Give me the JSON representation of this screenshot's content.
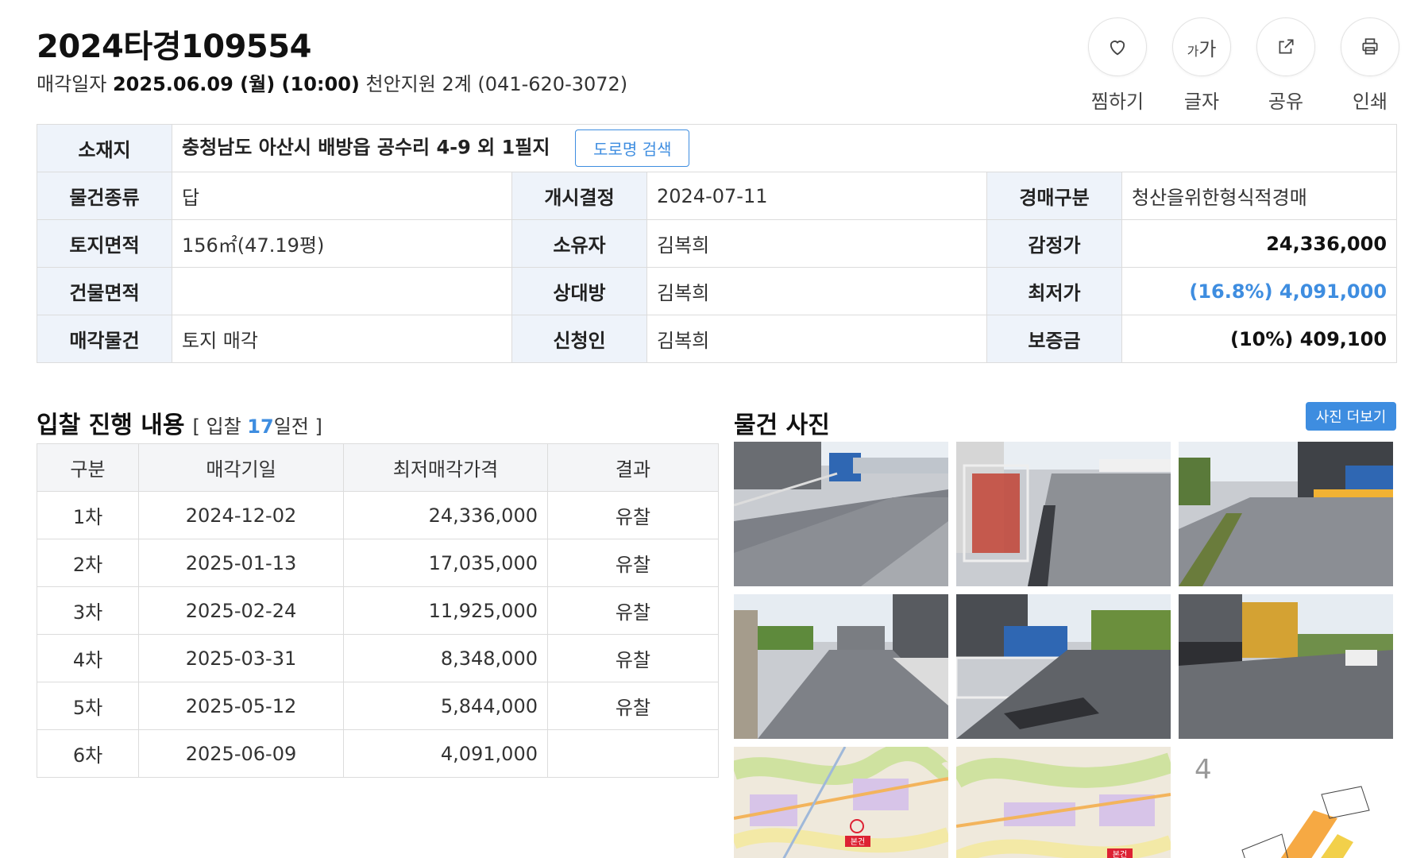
{
  "case": {
    "number": "2024타경109554",
    "sale_date_label": "매각일자",
    "sale_date": "2025.06.09 (월) (10:00)",
    "court": "천안지원 2계 (041-620-3072)"
  },
  "tools": {
    "like": "찜하기",
    "font_icon_small": "가",
    "font_icon_big": "가",
    "font": "글자",
    "share": "공유",
    "print": "인쇄"
  },
  "info": {
    "location_label": "소재지",
    "location": "충청남도 아산시 배방읍 공수리 4-9 외 1필지",
    "road_search": "도로명 검색",
    "type_label": "물건종류",
    "type": "답",
    "start_label": "개시결정",
    "start": "2024-07-11",
    "auction_kind_label": "경매구분",
    "auction_kind": "청산을위한형식적경매",
    "land_label": "토지면적",
    "land": "156㎡(47.19평)",
    "owner_label": "소유자",
    "owner": "김복희",
    "appraisal_label": "감정가",
    "appraisal": "24,336,000",
    "building_label": "건물면적",
    "building": "",
    "counterpart_label": "상대방",
    "counterpart": "김복희",
    "min_label": "최저가",
    "min": "(16.8%) 4,091,000",
    "sale_item_label": "매각물건",
    "sale_item": "토지 매각",
    "applicant_label": "신청인",
    "applicant": "김복희",
    "deposit_label": "보증금",
    "deposit": "(10%) 409,100"
  },
  "bidding": {
    "title": "입찰 진행 내용",
    "sub_open": "[ 입찰 ",
    "days": "17",
    "sub_close": "일전 ]",
    "headers": [
      "구분",
      "매각기일",
      "최저매각가격",
      "결과"
    ],
    "rows": [
      [
        "1차",
        "2024-12-02",
        "24,336,000",
        "유찰"
      ],
      [
        "2차",
        "2025-01-13",
        "17,035,000",
        "유찰"
      ],
      [
        "3차",
        "2025-02-24",
        "11,925,000",
        "유찰"
      ],
      [
        "4차",
        "2025-03-31",
        "8,348,000",
        "유찰"
      ],
      [
        "5차",
        "2025-05-12",
        "5,844,000",
        "유찰"
      ],
      [
        "6차",
        "2025-06-09",
        "4,091,000",
        ""
      ]
    ]
  },
  "photos": {
    "title": "물건 사진",
    "more": "사진 더보기",
    "map_marker_1": "본건",
    "map_marker_2": "본건",
    "diagram_numeral": "4",
    "items": [
      "road-photo",
      "road-photo",
      "road-photo",
      "road-photo",
      "road-photo",
      "road-photo",
      "map-image",
      "map-image",
      "site-diagram"
    ]
  },
  "colors": {
    "accent": "#3e8de0",
    "label_bg": "#eef3fa",
    "border": "#dcdcdc"
  }
}
